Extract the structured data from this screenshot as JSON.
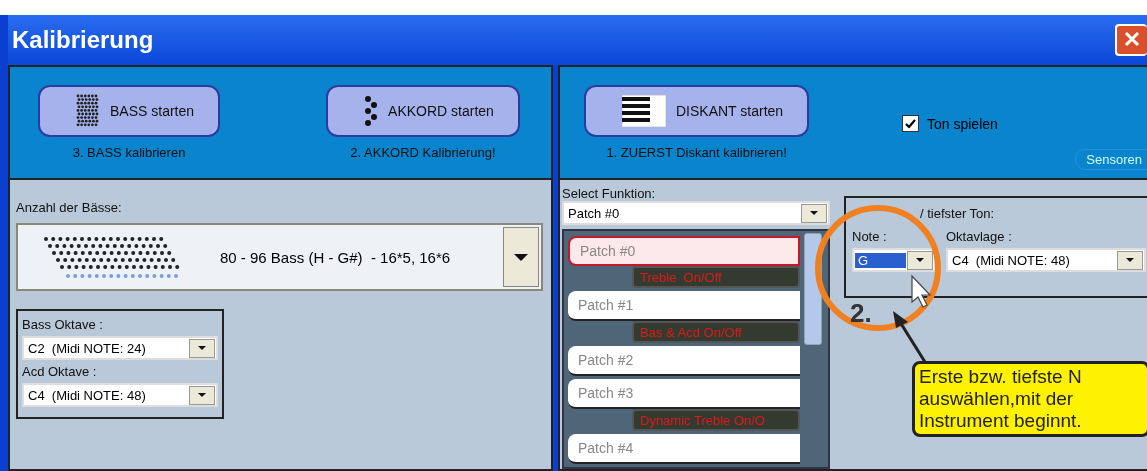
{
  "window": {
    "title": "Kalibrierung"
  },
  "left_panel": {
    "start_buttons": [
      {
        "label": "BASS starten",
        "caption": "3. BASS kalibrieren",
        "kind": "bass"
      },
      {
        "label": "AKKORD starten",
        "caption": "2. AKKORD Kalibrierung!",
        "kind": "chord"
      }
    ],
    "bass_count": {
      "label": "Anzahl der Bässe:",
      "value": "80 - 96 Bass (H - G#)  - 16*5, 16*6"
    },
    "octaves": [
      {
        "label": "Bass Oktave :",
        "value": "C2  (Midi NOTE: 24)"
      },
      {
        "label": "Acd Oktave :",
        "value": "C4  (Midi NOTE: 48)"
      }
    ]
  },
  "right_panel": {
    "start_buttons": [
      {
        "label": "DISKANT starten",
        "caption": "1. ZUERST Diskant kalibrieren!",
        "kind": "treble"
      }
    ],
    "play_tone": {
      "label": "Ton spielen",
      "checked": true
    },
    "sensors_button": "Sensoren",
    "function": {
      "label": "Select Funktion:",
      "value": "Patch #0"
    },
    "patches": [
      {
        "label": "Patch #0",
        "selected": true,
        "tag": "Treble  On/Off"
      },
      {
        "label": "Patch #1",
        "selected": false,
        "tag": "Bas & Acd On/Off"
      },
      {
        "label": "Patch #2",
        "selected": false
      },
      {
        "label": "Patch #3",
        "selected": false,
        "tag": "Dynamic Treble On/O"
      },
      {
        "label": "Patch #4",
        "selected": false
      }
    ],
    "first_note": {
      "title": "/ tiefster Ton:",
      "note": {
        "label": "Note :",
        "value": "G"
      },
      "octave": {
        "label": "Oktavlage :",
        "value": "C4  (Midi NOTE: 48)"
      }
    }
  },
  "annotation": {
    "step": "2.",
    "lines": [
      "Erste bzw. tiefste N",
      "auswählen,mit der",
      "Instrument beginnt."
    ]
  }
}
